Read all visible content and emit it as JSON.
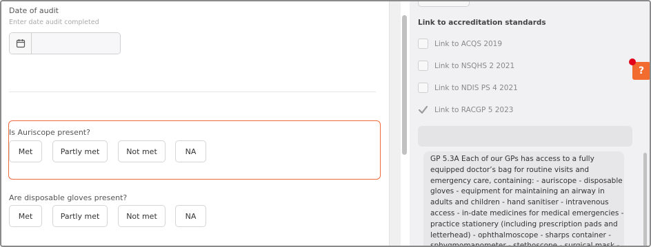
{
  "date_audit": {
    "label": "Date of audit",
    "hint": "Enter date audit completed",
    "value": ""
  },
  "questions": [
    {
      "text": "Is Auriscope present?",
      "options": [
        "Met",
        "Partly met",
        "Not met",
        "NA"
      ],
      "highlighted": true
    },
    {
      "text": "Are disposable gloves present?",
      "options": [
        "Met",
        "Partly met",
        "Not met",
        "NA"
      ],
      "highlighted": false
    }
  ],
  "accreditation": {
    "title": "Link to accreditation standards",
    "items": [
      {
        "label": "Link to ACQS 2019",
        "checked": false
      },
      {
        "label": "Link to NSQHS 2 2021",
        "checked": false
      },
      {
        "label": "Link to NDIS PS 4 2021",
        "checked": false
      },
      {
        "label": "Link to RACGP 5 2023",
        "checked": true
      }
    ]
  },
  "standard_text": "GP 5.3A Each of our GPs has access to a fully equipped doctor’s bag for routine visits and emergency care, containing: - auriscope - disposable gloves - equipment for maintaining an airway in adults and children - hand sanitiser - intravenous access - in-date medicines for medical emergencies - practice stationery (including prescription pads and letterhead) - ophthalmoscope - sharps container - sphygmomanometer - stethoscope - surgical mask -",
  "help": {
    "label": "?"
  },
  "colors": {
    "accent": "#ee6a3a",
    "help_button": "#f26b2f",
    "notification_dot": "#e3001b"
  }
}
